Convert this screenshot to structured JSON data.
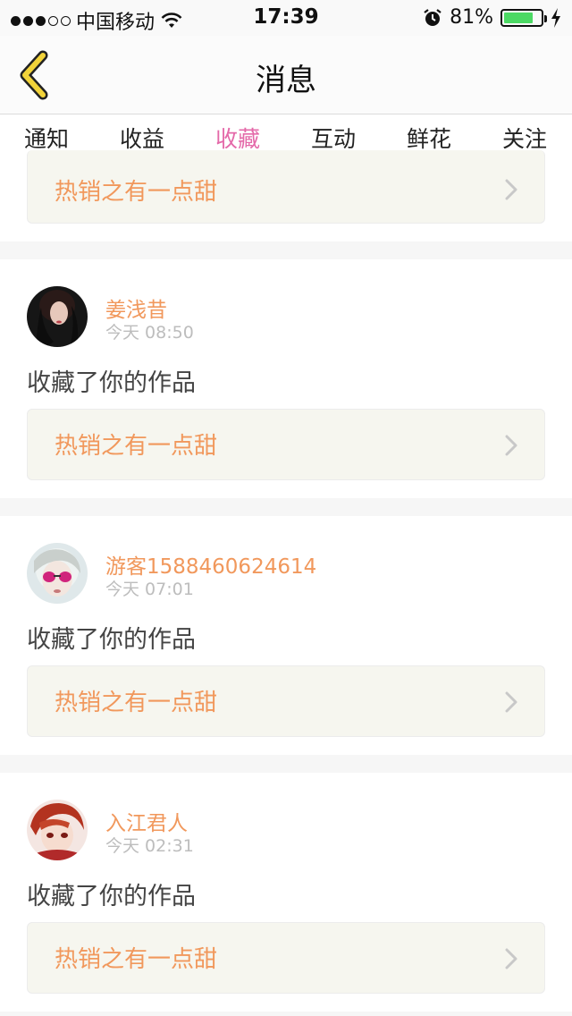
{
  "status_bar": {
    "carrier": "中国移动",
    "time": "17:39",
    "battery_percent": "81%",
    "battery_level": 0.81,
    "icons": [
      "signal-dots-icon",
      "wifi-icon",
      "alarm-icon",
      "battery-icon",
      "charging-bolt-icon"
    ]
  },
  "header": {
    "title": "消息",
    "back_icon": "chevron-left-icon",
    "back_icon_color": "#f2d33a"
  },
  "tabs": [
    {
      "label": "通知",
      "active": false
    },
    {
      "label": "收益",
      "active": false
    },
    {
      "label": "收藏",
      "active": true
    },
    {
      "label": "互动",
      "active": false
    },
    {
      "label": "鲜花",
      "active": false
    },
    {
      "label": "关注",
      "active": false
    }
  ],
  "colors": {
    "accent_pink": "#e469a9",
    "name_orange": "#f1985c",
    "time_gray": "#bdbdbd"
  },
  "partial_card": {
    "work_title": "热销之有一点甜"
  },
  "messages": [
    {
      "username": "姜浅昔",
      "time": "今天 08:50",
      "action": "收藏了你的作品",
      "work_title": "热销之有一点甜"
    },
    {
      "username": "游客1588460624614",
      "time": "今天 07:01",
      "action": "收藏了你的作品",
      "work_title": "热销之有一点甜"
    },
    {
      "username": "入江君人",
      "time": "今天 02:31",
      "action": "收藏了你的作品",
      "work_title": "热销之有一点甜"
    }
  ]
}
